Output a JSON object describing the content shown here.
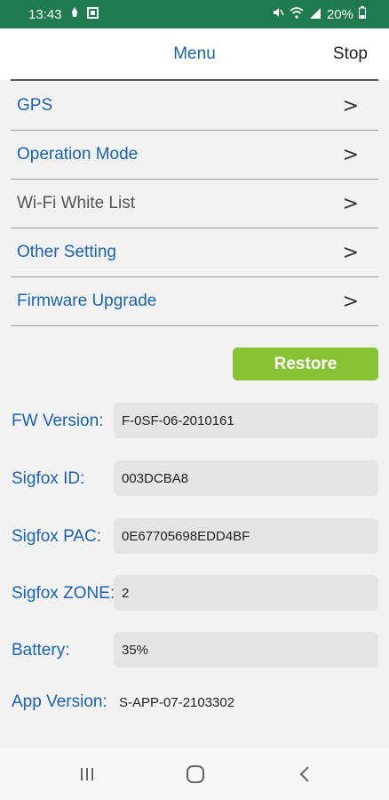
{
  "status_bar": {
    "time": "13:43",
    "left_icons": [
      "notification-icon",
      "square-icon"
    ],
    "right_icons": [
      "mute-icon",
      "wifi-icon",
      "signal-icon"
    ],
    "battery": "20%"
  },
  "header": {
    "title": "Menu",
    "stop_label": "Stop"
  },
  "menu": {
    "items": [
      {
        "label": "GPS"
      },
      {
        "label": "Operation Mode"
      },
      {
        "label": "Wi-Fi White List"
      },
      {
        "label": "Other Setting"
      },
      {
        "label": "Firmware Upgrade"
      }
    ]
  },
  "restore_label": "Restore",
  "info": {
    "fw_version": {
      "label": "FW Version:",
      "value": "F-0SF-06-2010161"
    },
    "sigfox_id": {
      "label": "Sigfox ID:",
      "value": "003DCBA8"
    },
    "sigfox_pac": {
      "label": "Sigfox PAC:",
      "value": "0E67705698EDD4BF"
    },
    "sigfox_zone": {
      "label": "Sigfox ZONE:",
      "value": "2"
    },
    "battery": {
      "label": "Battery:",
      "value": "35%"
    },
    "app_version": {
      "label": "App Version:",
      "value": "S-APP-07-2103302"
    }
  },
  "colors": {
    "status_bar": "#1f7a4f",
    "accent_blue": "#1a63b0",
    "restore_green": "#86c232"
  }
}
